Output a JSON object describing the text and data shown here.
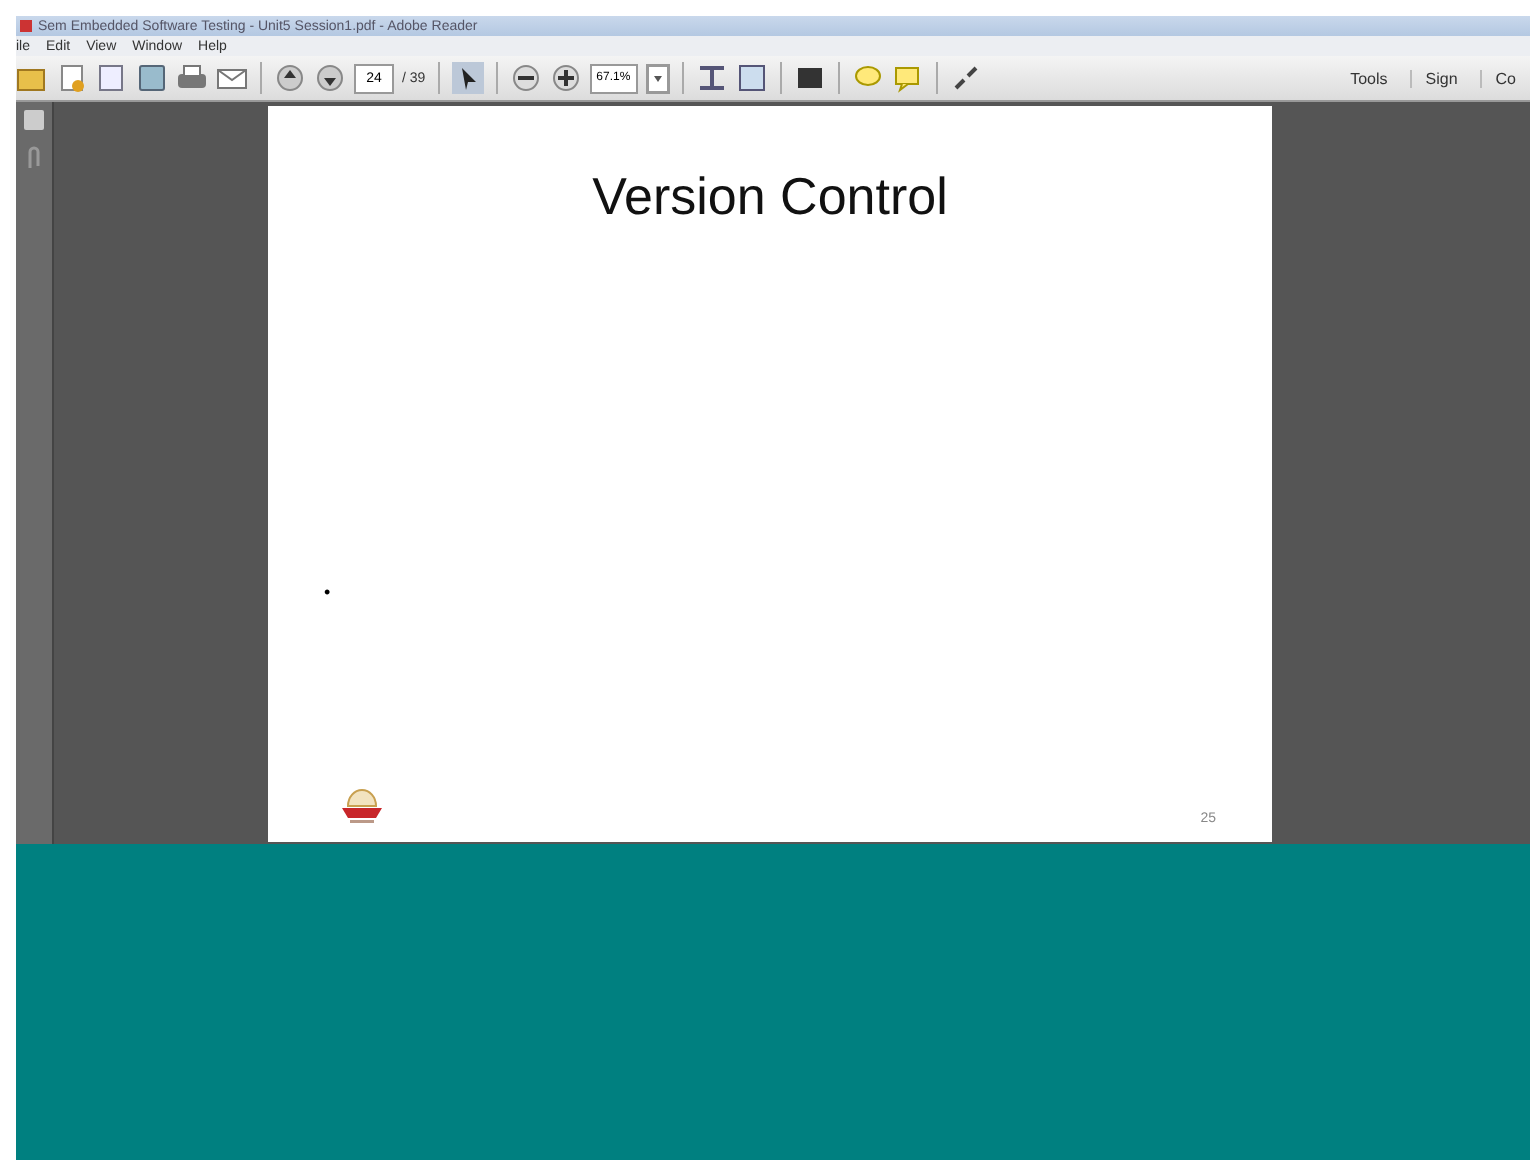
{
  "window": {
    "title": "Sem Embedded Software Testing - Unit5 Session1.pdf - Adobe Reader"
  },
  "menu": [
    "ile",
    "Edit",
    "View",
    "Window",
    "Help"
  ],
  "toolbar": {
    "page_number": "24",
    "page_total": "/ 39",
    "zoom": "67.1%",
    "right_buttons": [
      "Tools",
      "Sign",
      "Co"
    ]
  },
  "slide": {
    "title": "Version Control",
    "bullet": "•",
    "page_number": "25"
  }
}
